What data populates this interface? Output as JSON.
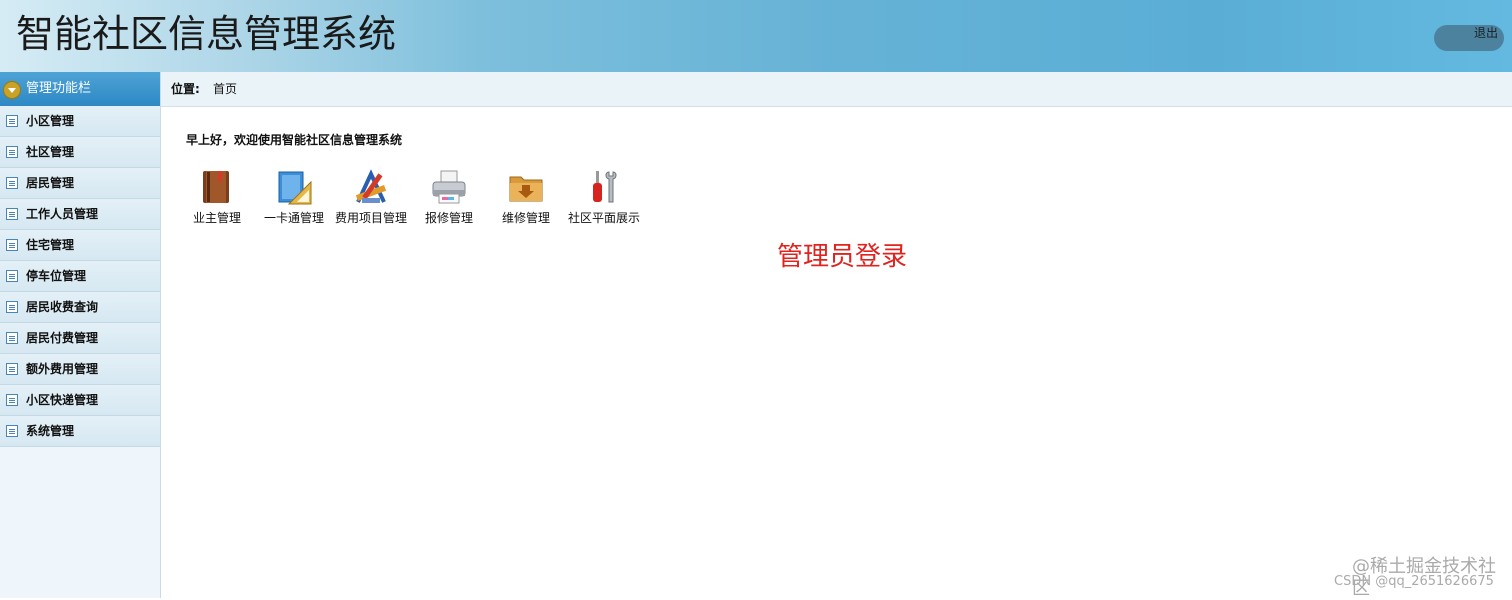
{
  "header": {
    "title": "智能社区信息管理系统",
    "logout_label": "退出"
  },
  "sidebar": {
    "head_label": "管理功能栏",
    "items": [
      {
        "label": "小区管理"
      },
      {
        "label": "社区管理"
      },
      {
        "label": "居民管理"
      },
      {
        "label": "工作人员管理"
      },
      {
        "label": "住宅管理"
      },
      {
        "label": "停车位管理"
      },
      {
        "label": "居民收费查询"
      },
      {
        "label": "居民付费管理"
      },
      {
        "label": "额外费用管理"
      },
      {
        "label": "小区快递管理"
      },
      {
        "label": "系统管理"
      }
    ]
  },
  "breadcrumb": {
    "key": "位置:",
    "value": "首页"
  },
  "main": {
    "welcome": "早上好，欢迎使用智能社区信息管理系统",
    "quick": [
      {
        "label": "业主管理",
        "icon": "book-icon"
      },
      {
        "label": "一卡通管理",
        "icon": "ruler-icon"
      },
      {
        "label": "费用项目管理",
        "icon": "tools-pencil-icon"
      },
      {
        "label": "报修管理",
        "icon": "printer-icon"
      },
      {
        "label": "维修管理",
        "icon": "folder-download-icon"
      },
      {
        "label": "社区平面展示",
        "icon": "screwdriver-wrench-icon"
      }
    ],
    "admin_login": "管理员登录"
  },
  "watermark": {
    "line1": "@稀土掘金技术社区",
    "line2": "CSDN @qq_2651626675"
  }
}
